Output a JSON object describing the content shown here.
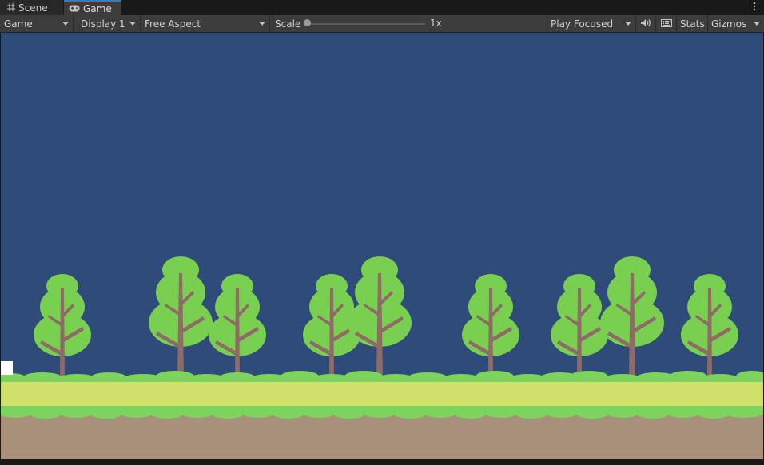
{
  "tabs": [
    {
      "label": "Scene",
      "icon": "grid-icon"
    },
    {
      "label": "Game",
      "icon": "gamepad-icon",
      "active": true
    }
  ],
  "toolbar": {
    "view_select": "Game",
    "display_select": "Display 1",
    "aspect_select": "Free Aspect",
    "scale_label": "Scale",
    "scale_value": "1x",
    "play_mode_select": "Play Focused",
    "stats_label": "Stats",
    "gizmos_label": "Gizmos"
  },
  "colors": {
    "sky": "#2f4b79",
    "tree_foliage": "#79cf4f",
    "tree_trunk": "#8e6b67",
    "grass_light": "#cfe06b",
    "grass_dark": "#7dd35d",
    "dirt": "#a8907b",
    "accent": "#3a79bb"
  }
}
